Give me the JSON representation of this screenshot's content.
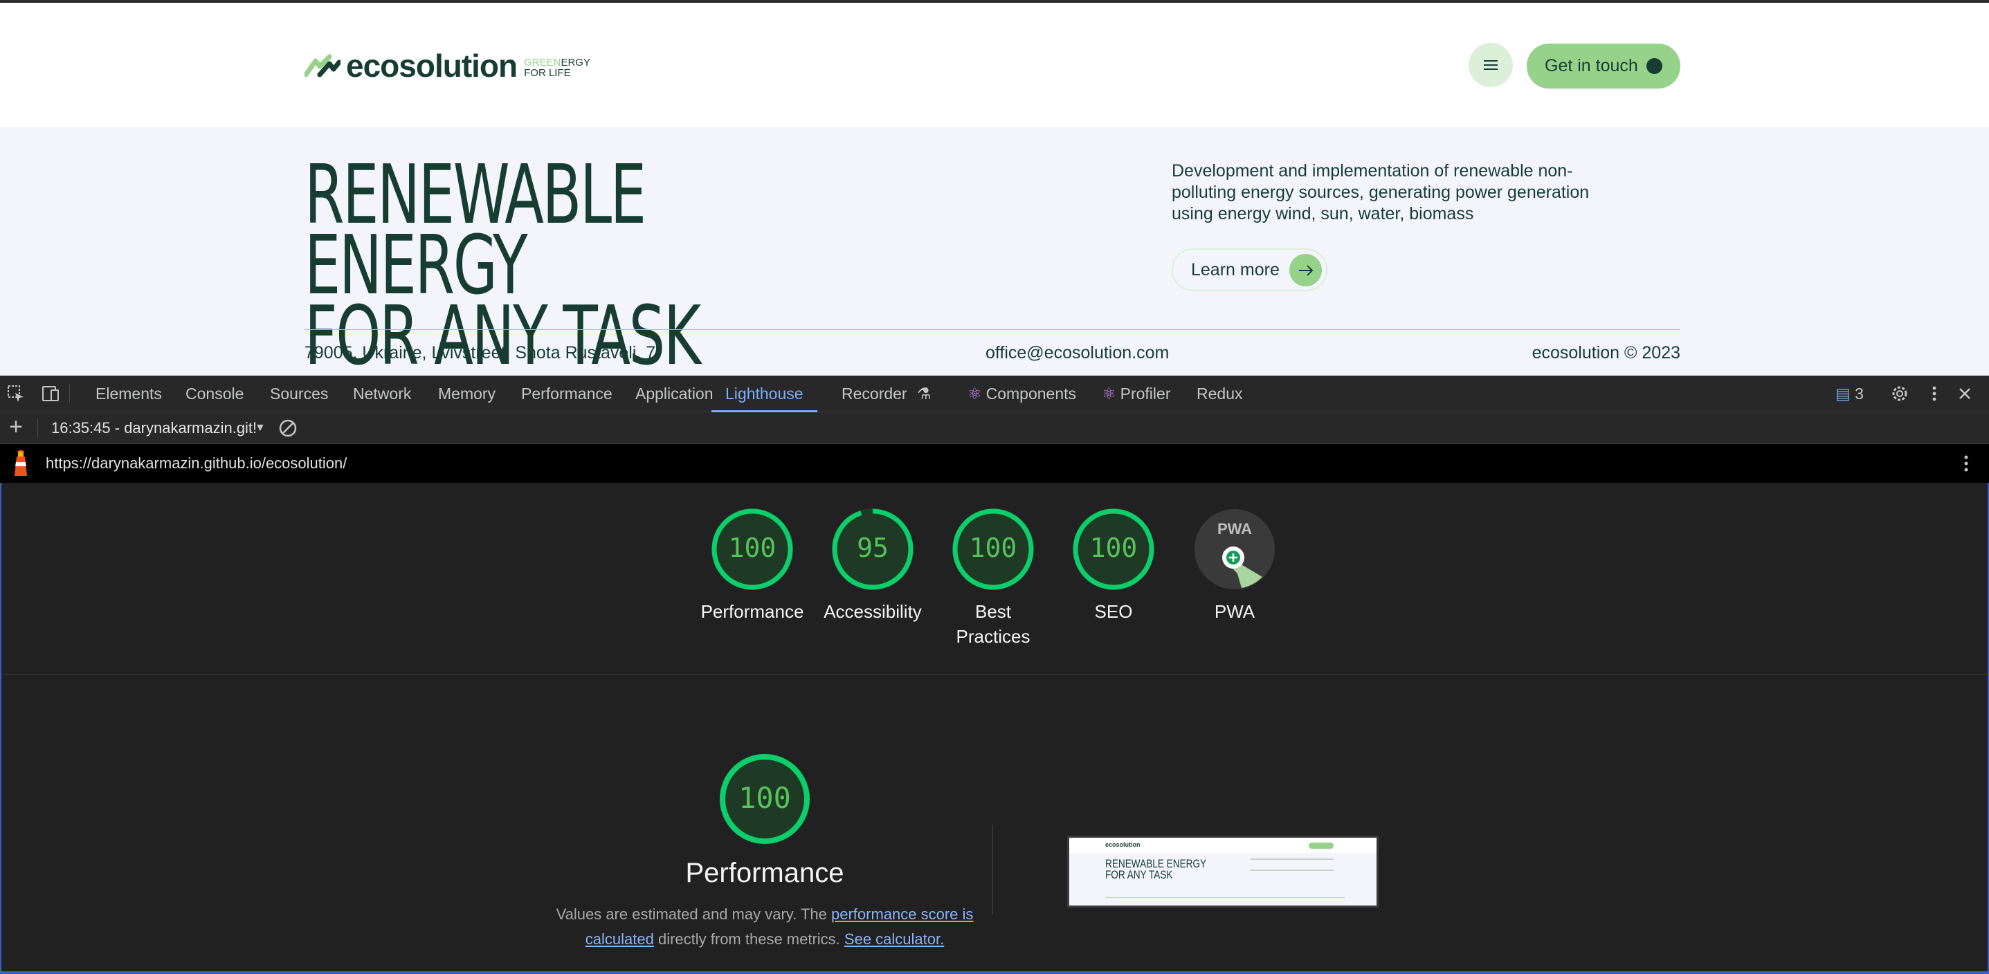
{
  "site": {
    "logo_name": "ecosolution",
    "logo_tag_green": "GREEN",
    "logo_tag_1": "ERGY",
    "logo_tag_2": "FOR LIFE",
    "get_in_touch": "Get in touch",
    "hero_line1": "RENEWABLE ENERGY",
    "hero_line2": "FOR ANY TASK",
    "description": "Development and implementation of renewable non-polluting energy sources, generating power generation using energy wind, sun, water, biomass",
    "learn_more": "Learn more",
    "address": "79005, Ukraine, Lvivstreet. Shota Rustaveli, 7",
    "email": "office@ecosolution.com",
    "copyright": "ecosolution © 2023",
    "colors": {
      "dark": "#173d33",
      "accent": "#97d28b",
      "light_accent": "#dcefd8",
      "bg": "#f3f5fa"
    }
  },
  "devtools": {
    "tabs": [
      "Elements",
      "Console",
      "Sources",
      "Network",
      "Memory",
      "Performance",
      "Application",
      "Lighthouse",
      "Recorder",
      "Components",
      "Profiler",
      "Redux"
    ],
    "active_tab": "Lighthouse",
    "issues_count": "3",
    "icons": [
      "inspect-element-icon",
      "device-toolbar-icon",
      "flask-icon",
      "issues-icon",
      "settings-gear-icon",
      "more-vertical-icon",
      "close-icon"
    ]
  },
  "lighthouse": {
    "report_label": "16:35:45 - darynakarmazin.git!",
    "url": "https://darynakarmazin.github.io/ecosolution/",
    "categories": [
      {
        "label": "Performance",
        "score": "100",
        "value": 100
      },
      {
        "label": "Accessibility",
        "score": "95",
        "value": 95
      },
      {
        "label": "Best Practices",
        "score": "100",
        "value": 100
      },
      {
        "label": "SEO",
        "score": "100",
        "value": 100
      },
      {
        "label": "PWA",
        "score": "PWA",
        "value": null
      }
    ],
    "performance": {
      "score": "100",
      "title": "Performance",
      "note_1": "Values are estimated and may vary. The ",
      "link_1": "performance score is calculated",
      "note_2": " directly from these metrics. ",
      "link_2": "See calculator."
    },
    "thumbnail": {
      "logo": "ecosolution",
      "title_1": "RENEWABLE ENERGY",
      "title_2": "FOR ANY TASK"
    },
    "colors": {
      "pass": "#0cce6b",
      "pass_text": "#57c15c",
      "ring_bg": "#1e3a24"
    }
  }
}
